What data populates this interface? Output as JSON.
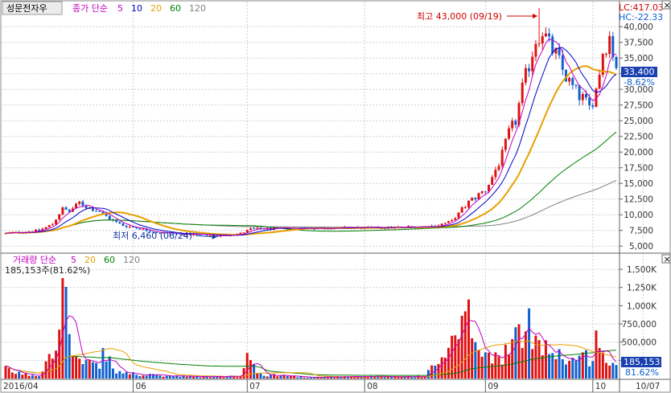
{
  "stock_name": "성문전자우",
  "price_legend": {
    "label": "종가 단순",
    "periods": [
      {
        "text": "5",
        "color": "#c000c0"
      },
      {
        "text": "10",
        "color": "#0000cc"
      },
      {
        "text": "20",
        "color": "#e8a000"
      },
      {
        "text": "60",
        "color": "#008000"
      },
      {
        "text": "120",
        "color": "#808080"
      }
    ]
  },
  "volume_legend": {
    "label": "거래량 단순",
    "periods": [
      {
        "text": "5",
        "color": "#c000c0"
      },
      {
        "text": "20",
        "color": "#e8a000"
      },
      {
        "text": "60",
        "color": "#008000"
      },
      {
        "text": "120",
        "color": "#808080"
      }
    ]
  },
  "volume_readout": "185,153주(81.62%)",
  "lc_text": "LC:417.03",
  "hc_text": "HC:-22.33",
  "high_annotation": "최고 43,000 (09/19)",
  "low_annotation": "최저 6,460 (06/24)",
  "current_price_tag": {
    "price": "33,400",
    "change": "-8.62%"
  },
  "current_volume_tag": {
    "volume": "185,153",
    "ratio": "81.62%"
  },
  "close_button": "×",
  "colors": {
    "up": "#e01010",
    "down": "#1060d0",
    "grid": "#c8d0d8",
    "tag_bg": "#1b40b0",
    "text_red": "#d00000"
  },
  "chart_data": {
    "type": "candlestick",
    "price_axis": {
      "ylim": [
        4000,
        44000
      ],
      "ticks": [
        5000,
        7500,
        10000,
        12500,
        15000,
        17500,
        20000,
        22500,
        25000,
        27500,
        30000,
        32500,
        35000,
        37500,
        40000
      ],
      "tick_labels": [
        "5,000",
        "7,500",
        "10,000",
        "12,500",
        "15,000",
        "17,500",
        "20,000",
        "22,500",
        "25,000",
        "27,500",
        "30,000",
        "32,500",
        "35,000",
        "37,500",
        "40,000"
      ]
    },
    "volume_axis": {
      "ylim": [
        0,
        1600000
      ],
      "ticks": [
        250000,
        500000,
        750000,
        1000000,
        1250000,
        1500000
      ],
      "tick_labels": [
        "250,000",
        "500,000",
        "750,000",
        "1,000K",
        "1,250K",
        "1,500K"
      ]
    },
    "x_axis": {
      "labels": [
        {
          "text": "2016/04",
          "index": 0
        },
        {
          "text": "06",
          "index": 38
        },
        {
          "text": "07",
          "index": 72
        },
        {
          "text": "08",
          "index": 107
        },
        {
          "text": "09",
          "index": 143
        },
        {
          "text": "10",
          "index": 175
        },
        {
          "text": "10/07",
          "index": 190
        }
      ]
    },
    "high": {
      "value": 43000,
      "date": "09/19",
      "index": 159
    },
    "low": {
      "value": 6460,
      "date": "06/24",
      "index": 63
    },
    "last_close": 33400,
    "last_volume": 185153,
    "anchors": [
      [
        0,
        7000
      ],
      [
        10,
        7500
      ],
      [
        14,
        8500
      ],
      [
        17,
        11000
      ],
      [
        19,
        10500
      ],
      [
        22,
        12000
      ],
      [
        24,
        11200
      ],
      [
        28,
        10500
      ],
      [
        32,
        9000
      ],
      [
        35,
        8300
      ],
      [
        40,
        7800
      ],
      [
        45,
        7200
      ],
      [
        52,
        6900
      ],
      [
        60,
        6800
      ],
      [
        63,
        6600
      ],
      [
        70,
        7000
      ],
      [
        73,
        7700
      ],
      [
        80,
        7800
      ],
      [
        95,
        7900
      ],
      [
        110,
        7900
      ],
      [
        118,
        8000
      ],
      [
        128,
        8200
      ],
      [
        133,
        9000
      ],
      [
        138,
        12000
      ],
      [
        143,
        14000
      ],
      [
        145,
        16000
      ],
      [
        148,
        19500
      ],
      [
        150,
        23000
      ],
      [
        152,
        25000
      ],
      [
        154,
        30000
      ],
      [
        156,
        34000
      ],
      [
        158,
        38000
      ],
      [
        160,
        39500
      ],
      [
        162,
        37000
      ],
      [
        164,
        35500
      ],
      [
        166,
        33000
      ],
      [
        168,
        31000
      ],
      [
        170,
        29500
      ],
      [
        172,
        28500
      ],
      [
        174,
        27000
      ],
      [
        176,
        30000
      ],
      [
        178,
        36000
      ],
      [
        180,
        38500
      ],
      [
        182,
        33400
      ]
    ],
    "volume_anchors": [
      [
        0,
        120000
      ],
      [
        5,
        60000
      ],
      [
        10,
        40000
      ],
      [
        14,
        480000
      ],
      [
        16,
        900000
      ],
      [
        18,
        1200000
      ],
      [
        20,
        300000
      ],
      [
        23,
        200000
      ],
      [
        28,
        160000
      ],
      [
        30,
        420000
      ],
      [
        32,
        100000
      ],
      [
        40,
        50000
      ],
      [
        55,
        25000
      ],
      [
        70,
        30000
      ],
      [
        73,
        350000
      ],
      [
        75,
        60000
      ],
      [
        90,
        20000
      ],
      [
        110,
        25000
      ],
      [
        125,
        30000
      ],
      [
        133,
        450000
      ],
      [
        136,
        650000
      ],
      [
        139,
        800000
      ],
      [
        141,
        350000
      ],
      [
        145,
        250000
      ],
      [
        150,
        400000
      ],
      [
        153,
        550000
      ],
      [
        156,
        700000
      ],
      [
        159,
        600000
      ],
      [
        162,
        400000
      ],
      [
        166,
        300000
      ],
      [
        170,
        250000
      ],
      [
        174,
        300000
      ],
      [
        176,
        520000
      ],
      [
        178,
        300000
      ],
      [
        180,
        250000
      ],
      [
        182,
        185153
      ]
    ]
  }
}
